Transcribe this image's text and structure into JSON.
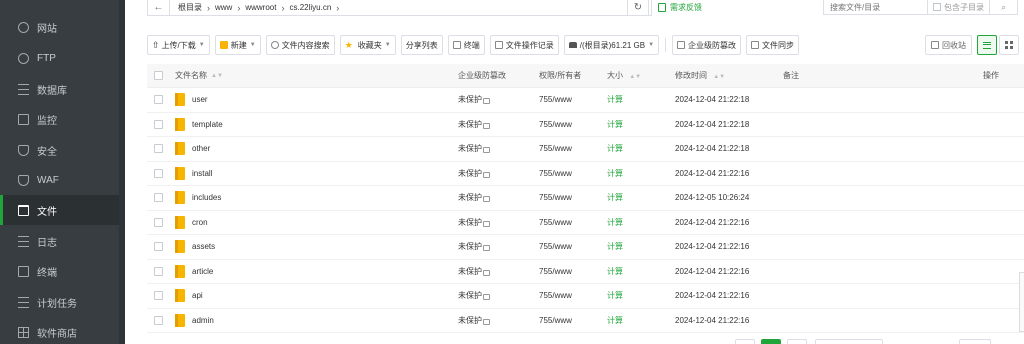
{
  "sidebar": {
    "items": [
      {
        "label": "网站",
        "icon": "globe-icon",
        "active": false
      },
      {
        "label": "FTP",
        "icon": "ftp-icon",
        "active": false
      },
      {
        "label": "数据库",
        "icon": "database-icon",
        "active": false
      },
      {
        "label": "监控",
        "icon": "monitor-icon",
        "active": false
      },
      {
        "label": "安全",
        "icon": "shield-icon",
        "active": false
      },
      {
        "label": "WAF",
        "icon": "waf-icon",
        "active": false
      },
      {
        "label": "文件",
        "icon": "folder-icon",
        "active": true
      },
      {
        "label": "日志",
        "icon": "log-icon",
        "active": false
      },
      {
        "label": "终端",
        "icon": "terminal-icon",
        "active": false
      },
      {
        "label": "计划任务",
        "icon": "cron-icon",
        "active": false
      },
      {
        "label": "软件商店",
        "icon": "store-icon",
        "active": false
      }
    ]
  },
  "path": {
    "crumbs": [
      "根目录",
      "www",
      "wwwroot",
      "cs.22liyu.cn"
    ],
    "feedback": "需求反馈"
  },
  "search": {
    "placeholder": "搜索文件/目录",
    "include_subdir": "包含子目录"
  },
  "toolbar": {
    "upload": "上传/下载",
    "new": "新建",
    "content_search": "文件内容搜索",
    "favorites": "收藏夹",
    "share_list": "分享列表",
    "terminal": "终端",
    "op_log": "文件操作记录",
    "disk": "/(根目录)61.21 GB",
    "tamper": "企业级防篡改",
    "sync": "文件同步",
    "recycle": "回收站"
  },
  "table": {
    "headers": {
      "name": "文件名称",
      "protection": "企业级防篡改",
      "permission": "权限/所有者",
      "size": "大小",
      "mtime": "修改时间",
      "note": "备注",
      "action": "操作"
    },
    "rows": [
      {
        "name": "user",
        "protection": "未保护",
        "permission": "755/www",
        "size": "计算",
        "mtime": "2024-12-04 21:22:18"
      },
      {
        "name": "template",
        "protection": "未保护",
        "permission": "755/www",
        "size": "计算",
        "mtime": "2024-12-04 21:22:18"
      },
      {
        "name": "other",
        "protection": "未保护",
        "permission": "755/www",
        "size": "计算",
        "mtime": "2024-12-04 21:22:18"
      },
      {
        "name": "install",
        "protection": "未保护",
        "permission": "755/www",
        "size": "计算",
        "mtime": "2024-12-04 21:22:16"
      },
      {
        "name": "includes",
        "protection": "未保护",
        "permission": "755/www",
        "size": "计算",
        "mtime": "2024-12-05 10:26:24"
      },
      {
        "name": "cron",
        "protection": "未保护",
        "permission": "755/www",
        "size": "计算",
        "mtime": "2024-12-04 21:22:16"
      },
      {
        "name": "assets",
        "protection": "未保护",
        "permission": "755/www",
        "size": "计算",
        "mtime": "2024-12-04 21:22:16"
      },
      {
        "name": "article",
        "protection": "未保护",
        "permission": "755/www",
        "size": "计算",
        "mtime": "2024-12-04 21:22:16"
      },
      {
        "name": "api",
        "protection": "未保护",
        "permission": "755/www",
        "size": "计算",
        "mtime": "2024-12-04 21:22:16"
      },
      {
        "name": "admin",
        "protection": "未保护",
        "permission": "755/www",
        "size": "计算",
        "mtime": "2024-12-04 21:22:16"
      }
    ]
  },
  "colors": {
    "accent": "#20a53a",
    "sidebar_bg": "#373d41",
    "folder": "#f7b500"
  }
}
